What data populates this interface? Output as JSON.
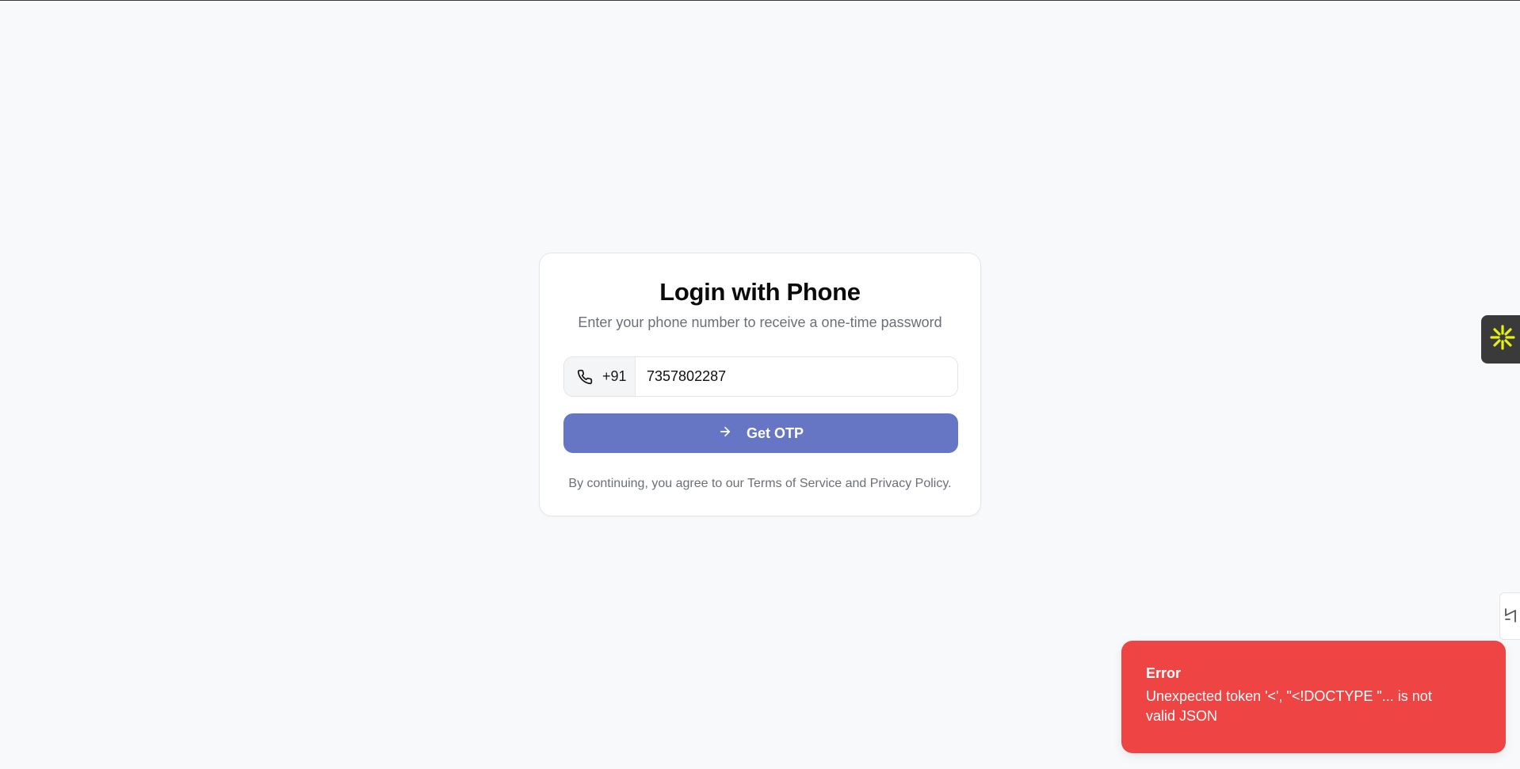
{
  "login": {
    "title": "Login with Phone",
    "subtitle": "Enter your phone number to receive a one-time password",
    "phone": {
      "icon": "phone-icon",
      "country_code": "+91",
      "value": "7357802287"
    },
    "submit": {
      "icon": "arrow-right-icon",
      "label": "Get OTP"
    },
    "terms_text": "By continuing, you agree to our Terms of Service and Privacy Policy."
  },
  "toast": {
    "title": "Error",
    "message": "Unexpected token '<', \"<!DOCTYPE \"... is not valid JSON"
  },
  "side_widgets": {
    "assistant_icon": "sparkle-icon",
    "tab_icon": "expand-icon"
  },
  "colors": {
    "page_background": "#f8f9fa",
    "button": "#6676c4",
    "error": "#ef4444",
    "widget_accent": "#e6f20a"
  }
}
